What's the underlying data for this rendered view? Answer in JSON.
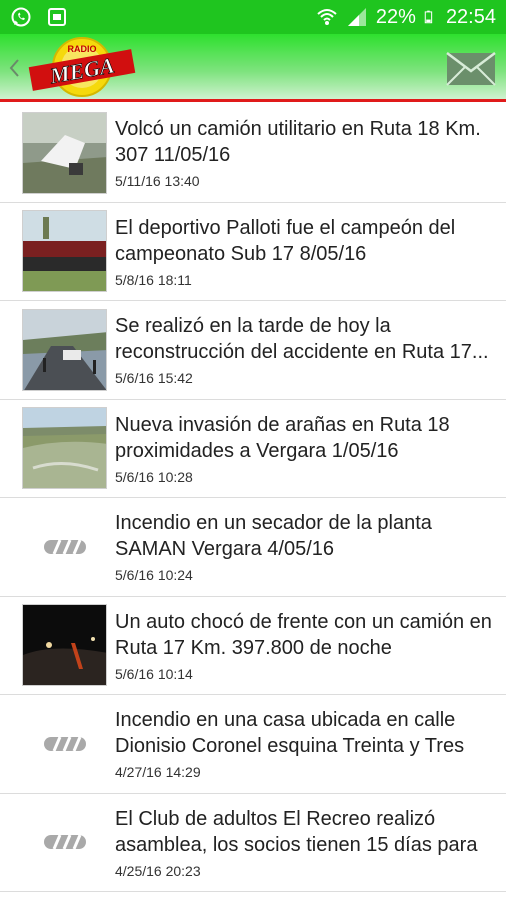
{
  "status_bar": {
    "battery": "22%",
    "time": "22:54",
    "icons": [
      "whatsapp-icon",
      "gallery-icon",
      "wifi-icon",
      "signal-icon",
      "battery-icon"
    ]
  },
  "app_bar": {
    "logo_text": "MEGA",
    "logo_top_text": "RADIO",
    "colors": {
      "bar_top": "#2ee02e",
      "accent_red": "#e01a1a",
      "status": "#1fc51f"
    }
  },
  "news": [
    {
      "title": "Volcó un camión utilitario en Ruta 18 Km. 307 11/05/16",
      "date": "5/11/16 13:40",
      "thumb": "truck"
    },
    {
      "title": "El deportivo Palloti fue el campeón del campeonato Sub 17 8/05/16",
      "date": "5/8/16 18:11",
      "thumb": "team"
    },
    {
      "title": "Se realizó en la tarde de hoy la reconstrucción del accidente en Ruta 17...",
      "date": "5/6/16 15:42",
      "thumb": "road"
    },
    {
      "title": "Nueva invasión de arañas en Ruta 18 proximidades a Vergara 1/05/16",
      "date": "5/6/16 10:28",
      "thumb": "field"
    },
    {
      "title": "Incendio en un secador de la planta SAMAN Vergara 4/05/16",
      "date": "5/6/16 10:24",
      "thumb": "none"
    },
    {
      "title": "Un auto chocó de frente con un camión en Ruta 17 Km. 397.800 de noche",
      "date": "5/6/16 10:14",
      "thumb": "night"
    },
    {
      "title": "Incendio en una casa ubicada en calle Dionisio Coronel esquina Treinta y Tres",
      "date": "4/27/16 14:29",
      "thumb": "none"
    },
    {
      "title": "El Club de adultos El Recreo realizó asamblea, los socios tienen 15 días para",
      "date": "4/25/16 20:23",
      "thumb": "none"
    }
  ]
}
